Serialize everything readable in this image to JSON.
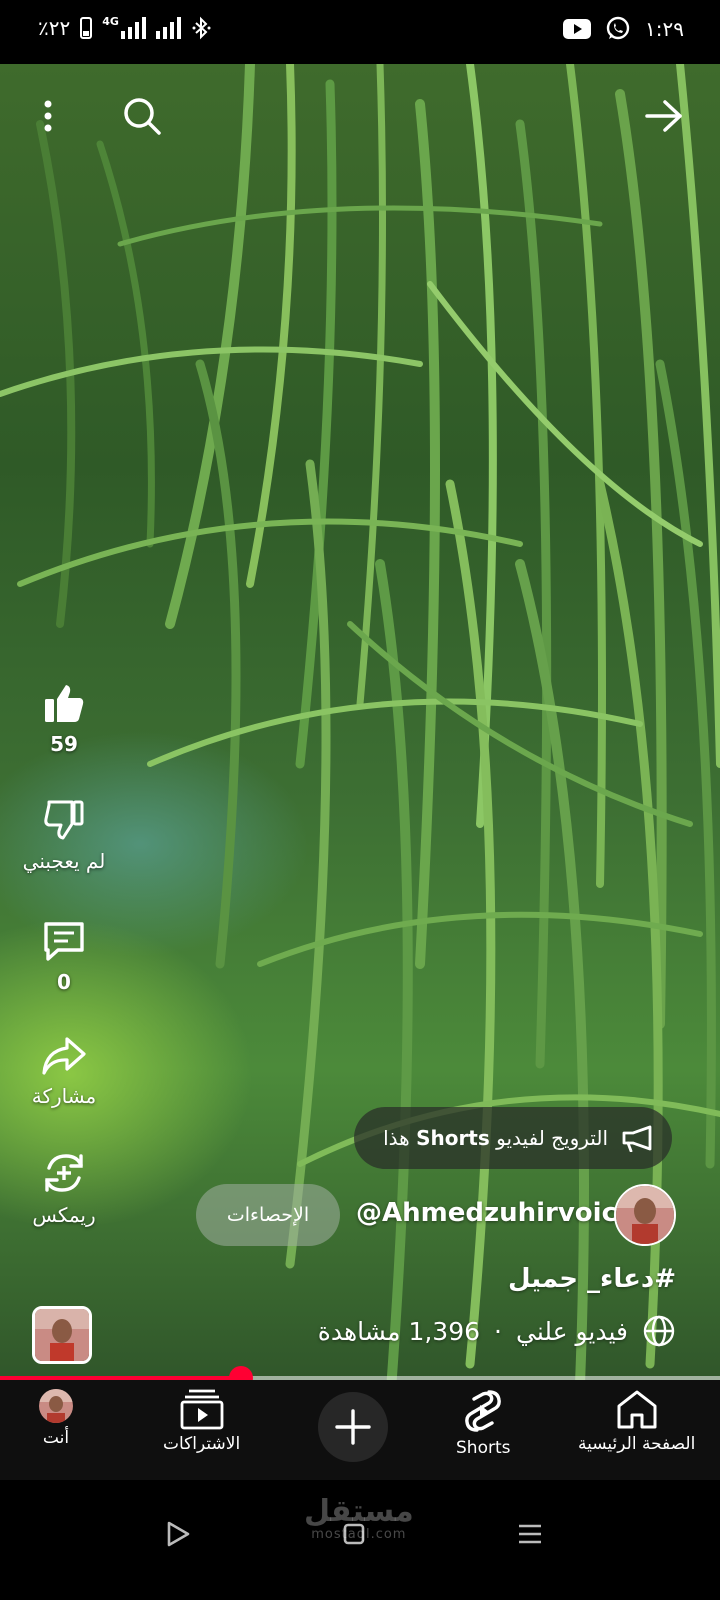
{
  "status_bar": {
    "battery": "٪٢٢",
    "network": "4G",
    "time": "١:٢٩"
  },
  "top_bar": {
    "icons": [
      "more-vert-icon",
      "search-icon",
      "arrow-forward-icon"
    ]
  },
  "actions": {
    "like_count": "59",
    "dislike_label": "لم يعجبني",
    "comment_count": "0",
    "share_label": "مشاركة",
    "remix_label": "ريمكس"
  },
  "promo": {
    "prefix": "الترويج لفيديو",
    "bold": "Shorts",
    "suffix": "هذا"
  },
  "channel": {
    "handle": "@Ahmedzuhirvoice",
    "stats_button": "الإحصاءات"
  },
  "video": {
    "caption": "#دعاء_ جميل",
    "visibility": "فيديو علني",
    "separator": "·",
    "views": "1,396 مشاهدة",
    "progress": 0.335
  },
  "bottom_nav": {
    "home": "الصفحة الرئيسية",
    "shorts": "Shorts",
    "subscriptions": "الاشتراكات",
    "you": "أنت"
  },
  "watermark": {
    "line1": "مستقل",
    "line2": "mostaql.com"
  },
  "colors": {
    "accent": "#ff0033",
    "nav_bg": "#0f0f0f"
  }
}
